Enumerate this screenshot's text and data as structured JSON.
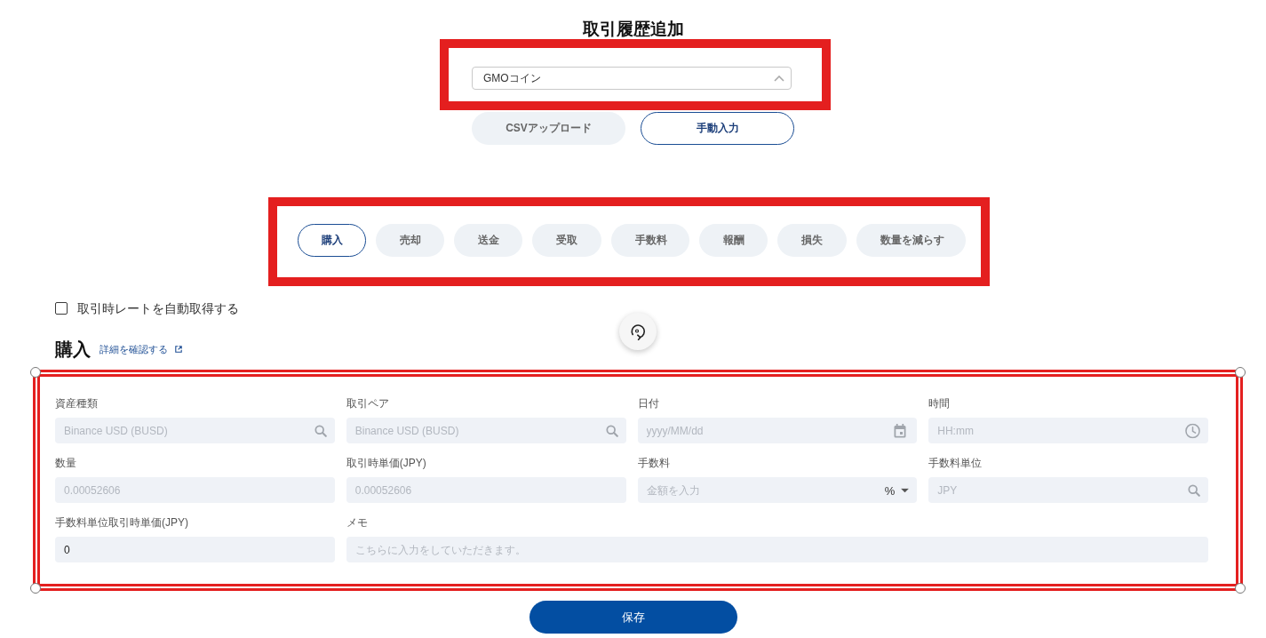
{
  "title": "取引履歴追加",
  "exchange_select": {
    "value": "GMOコイン",
    "highlight": {
      "kind": "box"
    }
  },
  "input_modes": [
    {
      "label": "CSVアップロード",
      "selected": false
    },
    {
      "label": "手動入力",
      "selected": true
    }
  ],
  "transaction_types": {
    "highlight": {
      "kind": "box"
    },
    "tabs": [
      {
        "label": "購入",
        "selected": true
      },
      {
        "label": "売却",
        "selected": false
      },
      {
        "label": "送金",
        "selected": false
      },
      {
        "label": "受取",
        "selected": false
      },
      {
        "label": "手数料",
        "selected": false
      },
      {
        "label": "報酬",
        "selected": false
      },
      {
        "label": "損失",
        "selected": false
      },
      {
        "label": "数量を減らす",
        "selected": false
      }
    ]
  },
  "auto_rate": {
    "label": "取引時レートを自動取得する",
    "checked": false
  },
  "section": {
    "heading": "購入",
    "link": "詳細を確認する"
  },
  "form": {
    "highlight": {
      "kind": "selection"
    },
    "fields": [
      {
        "label": "資産種類",
        "kind": "search",
        "placeholder": "Binance USD (BUSD)"
      },
      {
        "label": "取引ペア",
        "kind": "search",
        "placeholder": "Binance USD (BUSD)"
      },
      {
        "label": "日付",
        "kind": "date",
        "placeholder": "yyyy/MM/dd"
      },
      {
        "label": "時間",
        "kind": "time",
        "placeholder": "HH:mm"
      },
      {
        "label": "数量",
        "kind": "text",
        "placeholder": "0.00052606"
      },
      {
        "label": "取引時単価(JPY)",
        "kind": "text",
        "placeholder": "0.00052606"
      },
      {
        "label": "手数料",
        "kind": "amount",
        "placeholder": "金額を入力",
        "unit": "%"
      },
      {
        "label": "手数料単位",
        "kind": "search",
        "placeholder": "JPY"
      },
      {
        "label": "手数料単位取引時単価(JPY)",
        "kind": "text",
        "value": "0"
      },
      {
        "label": "メモ",
        "kind": "memo",
        "placeholder": "こちらに入力をしていただきます。"
      }
    ]
  },
  "save_button": {
    "label": "保存"
  }
}
